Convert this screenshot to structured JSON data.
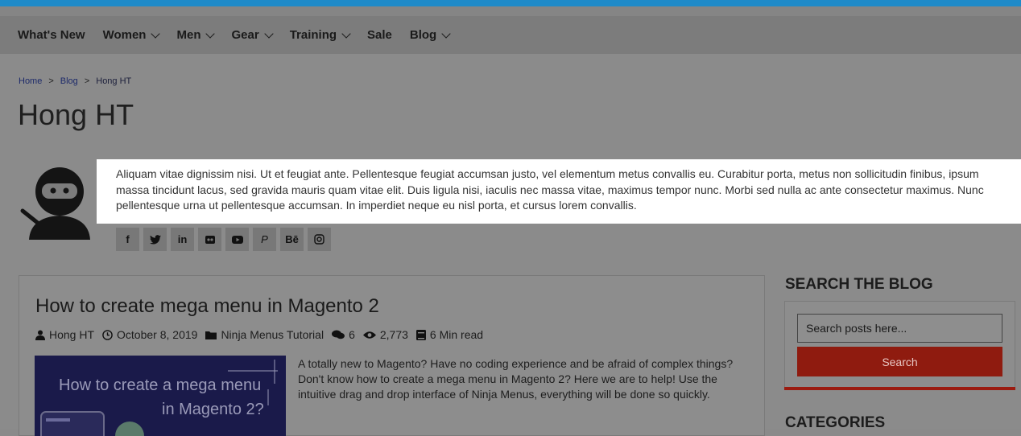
{
  "nav": {
    "items": [
      {
        "label": "What's New",
        "dropdown": false
      },
      {
        "label": "Women",
        "dropdown": true
      },
      {
        "label": "Men",
        "dropdown": true
      },
      {
        "label": "Gear",
        "dropdown": true
      },
      {
        "label": "Training",
        "dropdown": true
      },
      {
        "label": "Sale",
        "dropdown": false
      },
      {
        "label": "Blog",
        "dropdown": true
      }
    ]
  },
  "breadcrumb": {
    "home": "Home",
    "sep": ">",
    "blog": "Blog",
    "current": "Hong HT"
  },
  "page": {
    "title": "Hong HT"
  },
  "author": {
    "bio": "Aliquam vitae dignissim nisi. Ut et feugiat ante. Pellentesque feugiat accumsan justo, vel elementum metus convallis eu. Curabitur porta, metus non sollicitudin finibus, ipsum massa tincidunt lacus, sed gravida mauris quam vitae elit. Duis ligula nisi, iaculis nec massa vitae, maximus tempor nunc. Morbi sed nulla ac ante consectetur maximus. Nunc pellentesque urna ut pellentesque accumsan. In imperdiet neque eu nisl porta, et cursus lorem convallis.",
    "socials": [
      {
        "icon": "facebook-icon",
        "glyph": "f"
      },
      {
        "icon": "twitter-icon",
        "glyph": "🐦"
      },
      {
        "icon": "linkedin-icon",
        "glyph": "in"
      },
      {
        "icon": "flickr-icon",
        "glyph": "••"
      },
      {
        "icon": "youtube-icon",
        "glyph": "▶"
      },
      {
        "icon": "pinterest-icon",
        "glyph": "P"
      },
      {
        "icon": "behance-icon",
        "glyph": "Bē"
      },
      {
        "icon": "instagram-icon",
        "glyph": "◎"
      }
    ]
  },
  "post": {
    "title": "How to create mega menu in Magento 2",
    "author": "Hong HT",
    "date": "October 8, 2019",
    "category": "Ninja Menus Tutorial",
    "comments": "6",
    "views": "2,773",
    "read_time": "6 Min read",
    "thumb_line1": "How to create a mega menu",
    "thumb_line2": "in Magento 2?",
    "excerpt": "A totally new to Magento? Have no coding experience and be afraid of complex things? Don't know how to create a mega menu in Magento 2? Here we are to help! Use the intuitive drag and drop interface of Ninja Menus, everything will be done so quickly."
  },
  "sidebar": {
    "search_title": "SEARCH THE BLOG",
    "search_placeholder": "Search posts here...",
    "search_button": "Search",
    "categories_title": "CATEGORIES"
  },
  "colors": {
    "accent_red": "#8f1b0f",
    "top_strip": "#1f8ac8"
  }
}
